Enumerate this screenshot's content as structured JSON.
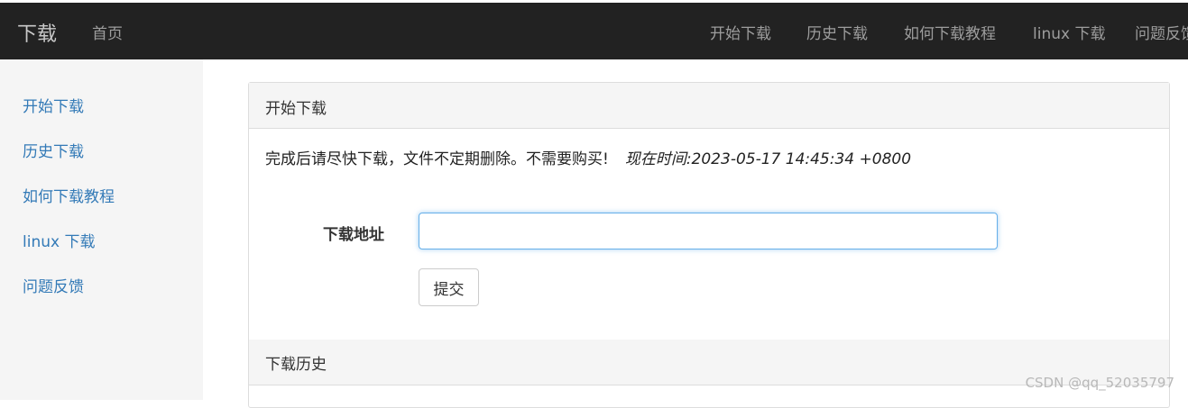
{
  "topbar": {
    "brand": "下载",
    "home": "首页",
    "nav": [
      "开始下载",
      "历史下载",
      "如何下载教程",
      "linux 下载",
      "问题反馈"
    ]
  },
  "sidebar": {
    "items": [
      "开始下载",
      "历史下载",
      "如何下载教程",
      "linux 下载",
      "问题反馈"
    ]
  },
  "panel": {
    "title": "开始下载",
    "notice": "完成后请尽快下载，文件不定期删除。不需要购买!",
    "time": "现在时间:2023-05-17 14:45:34 +0800",
    "form": {
      "label": "下载地址",
      "input_value": "",
      "input_placeholder": "",
      "submit_label": "提交"
    },
    "history_title": "下载历史"
  },
  "watermark": "CSDN @qq_52035797",
  "colors": {
    "topbar_bg": "#222222",
    "link": "#337ab7",
    "sidebar_bg": "#f5f5f5",
    "input_focus": "#66afe9"
  }
}
